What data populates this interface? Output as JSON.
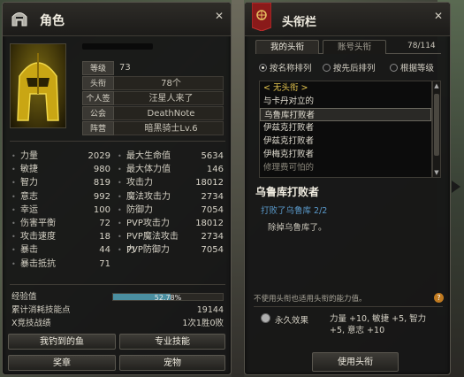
{
  "left": {
    "title": "角色",
    "info": [
      {
        "key": "等级",
        "value": "73",
        "center": false
      },
      {
        "key": "头衔",
        "value": "78个",
        "center": true
      },
      {
        "key": "个人签",
        "value": "汪星人来了",
        "center": true
      },
      {
        "key": "公会",
        "value": "DeathNote",
        "center": true
      },
      {
        "key": "阵营",
        "value": "暗黑骑士Lv.6",
        "center": true
      }
    ],
    "stats": [
      [
        {
          "label": "力量",
          "value": "2029"
        },
        {
          "label": "最大生命值",
          "value": "5634"
        }
      ],
      [
        {
          "label": "敏捷",
          "value": "980"
        },
        {
          "label": "最大体力值",
          "value": "146"
        }
      ],
      [
        {
          "label": "智力",
          "value": "819"
        },
        {
          "label": "攻击力",
          "value": "18012"
        }
      ],
      [
        {
          "label": "意志",
          "value": "992"
        },
        {
          "label": "魔法攻击力",
          "value": "2734"
        }
      ],
      [
        {
          "label": "幸运",
          "value": "100"
        },
        {
          "label": "防御力",
          "value": "7054"
        }
      ],
      [
        {
          "label": "伤害平衡",
          "value": "72"
        },
        {
          "label": "PVP攻击力",
          "value": "18012"
        }
      ],
      [
        {
          "label": "攻击速度",
          "value": "18"
        },
        {
          "label": "PVP魔法攻击力",
          "value": "2734"
        }
      ],
      [
        {
          "label": "暴击",
          "value": "44"
        },
        {
          "label": "PVP防御力",
          "value": "7054"
        }
      ],
      [
        {
          "label": "暴击抵抗",
          "value": "71"
        },
        null
      ]
    ],
    "xp": {
      "label": "经验值",
      "percent_text": "52.78%",
      "fraction": 0.5278
    },
    "extra": [
      {
        "label": "累计消耗技能点",
        "value": "19144"
      },
      {
        "label": "X竞技战绩",
        "value": "1次1胜0败"
      }
    ],
    "buttons": {
      "fish": "我钓到的鱼",
      "skill": "专业技能",
      "award": "奖章",
      "pet": "宠物"
    }
  },
  "right": {
    "title": "头衔栏",
    "tabs": {
      "mine": "我的头衔",
      "account": "账号头衔"
    },
    "count": "78/114",
    "sort": {
      "by_name": "按名称排列",
      "by_order": "按先后排列",
      "by_level": "根据等级"
    },
    "titles": [
      {
        "text": "< 无头衔 >",
        "style": "gold"
      },
      {
        "text": "与卡丹对立的",
        "style": ""
      },
      {
        "text": "乌鲁库打败者",
        "style": "sel"
      },
      {
        "text": "伊兹克打败者",
        "style": ""
      },
      {
        "text": "伊兹克打败者",
        "style": ""
      },
      {
        "text": "伊梅克打败者",
        "style": ""
      },
      {
        "text": "修理费可怕的",
        "style": "dim"
      }
    ],
    "detail": {
      "title": "乌鲁库打败者",
      "requirement": "打败了乌鲁库 2/2",
      "description": "除掉乌鲁库了。"
    },
    "note": "不使用头衔也适用头衔的能力值。",
    "effect": {
      "label": "永久效果",
      "line1": "力量 +10, 敏捷 +5, 智力",
      "line2": "+5, 意志 +10"
    },
    "use_button": "使用头衔"
  }
}
